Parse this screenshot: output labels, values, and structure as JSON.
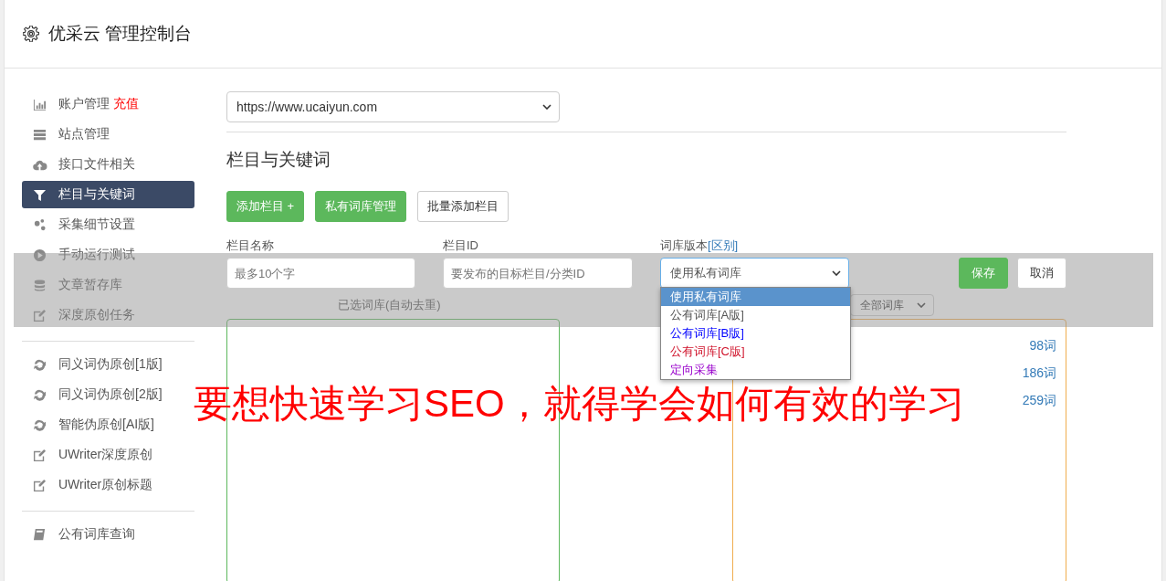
{
  "header": {
    "title": "优采云 管理控制台"
  },
  "sidebar": {
    "groups": [
      {
        "items": [
          {
            "label": "账户管理",
            "badge": "充值",
            "selected": false
          },
          {
            "label": "站点管理",
            "selected": false
          },
          {
            "label": "接口文件相关",
            "selected": false
          },
          {
            "label": "栏目与关键词",
            "selected": true
          },
          {
            "label": "采集细节设置",
            "selected": false
          },
          {
            "label": "手动运行测试",
            "selected": false
          },
          {
            "label": "文章暂存库",
            "selected": false
          },
          {
            "label": "深度原创任务",
            "selected": false
          }
        ]
      },
      {
        "items": [
          {
            "label": "同义词伪原创[1版]",
            "selected": false
          },
          {
            "label": "同义词伪原创[2版]",
            "selected": false
          },
          {
            "label": "智能伪原创[AI版]",
            "selected": false
          },
          {
            "label": "UWriter深度原创",
            "selected": false
          },
          {
            "label": "UWriter原创标题",
            "selected": false
          }
        ]
      },
      {
        "items": [
          {
            "label": "公有词库查询",
            "selected": false
          }
        ]
      }
    ]
  },
  "site_select": {
    "value": "https://www.ucaiyun.com"
  },
  "section_title": "栏目与关键词",
  "toolbar": [
    {
      "label": "添加栏目 +",
      "kind": "primary"
    },
    {
      "label": "私有词库管理",
      "kind": "primary"
    },
    {
      "label": "批量添加栏目",
      "kind": "default"
    }
  ],
  "form": {
    "name_label": "栏目名称",
    "name_placeholder": "最多10个字",
    "id_label": "栏目ID",
    "id_placeholder": "要发布的目标栏目/分类ID",
    "version_label": "词库版本",
    "version_link": "[区别]",
    "version_value": "使用私有词库",
    "save": "保存",
    "cancel": "取消"
  },
  "version_options": [
    {
      "label": "使用私有词库",
      "selected": true
    },
    {
      "label": "公有词库[A版]",
      "color": "#555555",
      "selected": false
    },
    {
      "label": "公有词库[B版]",
      "color": "#0000ff",
      "selected": false
    },
    {
      "label": "公有词库[C版]",
      "color": "#d0142c",
      "selected": false
    },
    {
      "label": "定向采集",
      "color": "#9900cc",
      "selected": false
    }
  ],
  "selected_title": "已选词库(自动去重)",
  "library_filter": "全部词库",
  "library_rows": [
    {
      "count": "98词"
    },
    {
      "count": "186词"
    },
    {
      "count": "259词"
    }
  ],
  "overlay_caption": "要想快速学习SEO，就得学会如何有效的学习"
}
